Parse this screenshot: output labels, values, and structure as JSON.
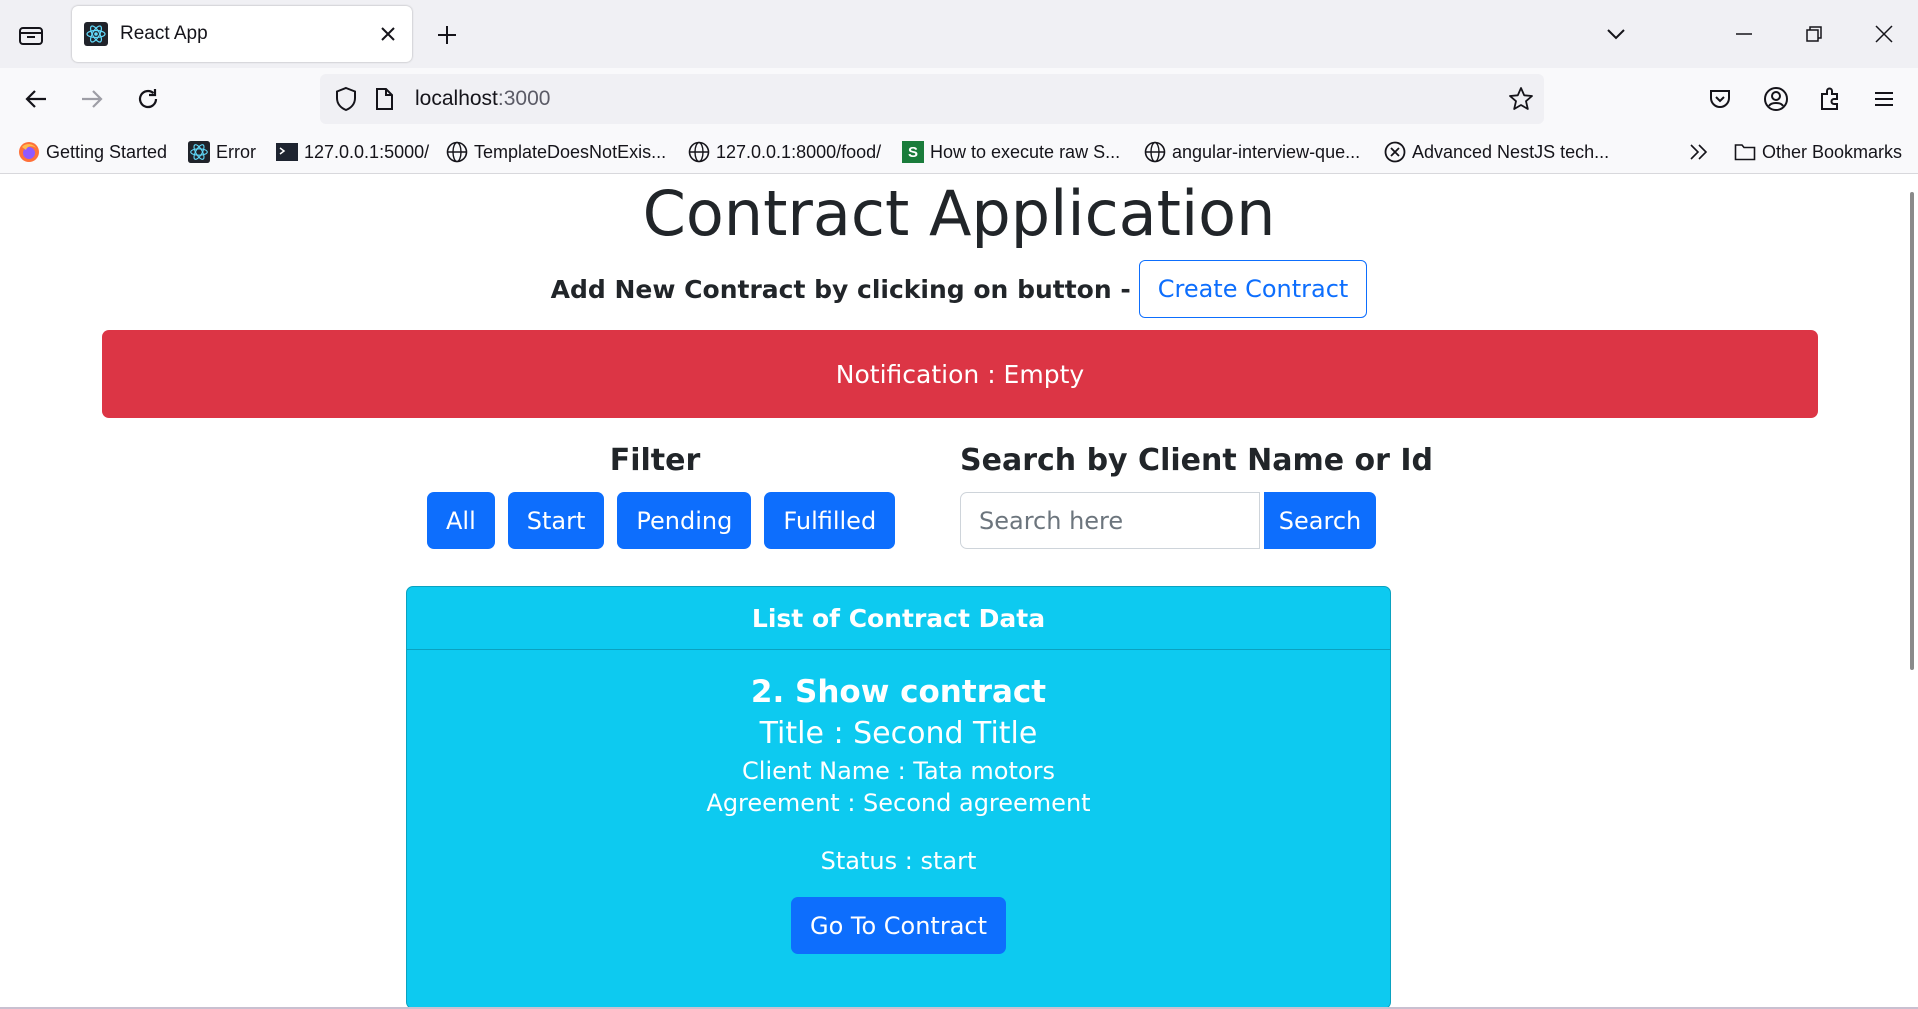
{
  "browser": {
    "tab_title": "React App",
    "url_host": "localhost",
    "url_port": ":3000",
    "bookmarks": [
      {
        "label": "Getting Started",
        "icon": "firefox-icon"
      },
      {
        "label": "Error",
        "icon": "react-icon"
      },
      {
        "label": "127.0.0.1:5000/",
        "icon": "terminal-icon"
      },
      {
        "label": "TemplateDoesNotExis...",
        "icon": "globe-icon"
      },
      {
        "label": "127.0.0.1:8000/food/",
        "icon": "globe-icon"
      },
      {
        "label": "How to execute raw S...",
        "icon": "s-icon"
      },
      {
        "label": "angular-interview-que...",
        "icon": "globe-icon"
      },
      {
        "label": "Advanced NestJS tech...",
        "icon": "x-circle-icon"
      }
    ],
    "other_bookmarks": "Other Bookmarks"
  },
  "app": {
    "title": "Contract Application",
    "add_label": "Add New Contract by clicking on button -",
    "create_button": "Create Contract",
    "notification": "Notification : Empty",
    "filter": {
      "heading": "Filter",
      "buttons": [
        "All",
        "Start",
        "Pending",
        "Fulfilled"
      ]
    },
    "search": {
      "heading": "Search by Client Name or Id",
      "placeholder": "Search here",
      "button": "Search"
    },
    "list": {
      "header": "List of Contract Data",
      "contract": {
        "heading": "2. Show contract",
        "title": "Title : Second Title",
        "client": "Client Name : Tata motors",
        "agreement": "Agreement : Second agreement",
        "status": "Status : start",
        "go_button": "Go To Contract"
      }
    }
  }
}
